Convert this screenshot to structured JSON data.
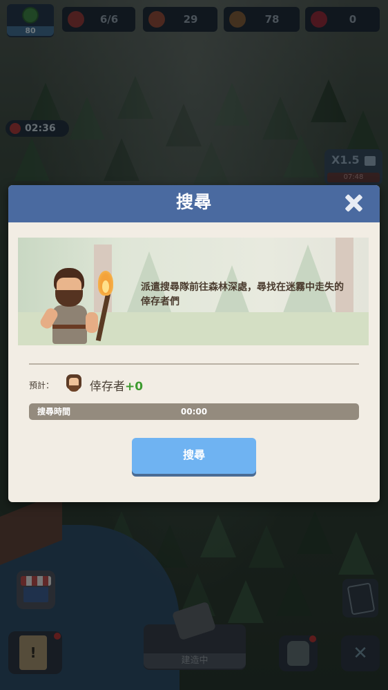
{
  "hud": {
    "level": "80",
    "resources": [
      {
        "icon": "survivor-capacity-icon",
        "value": "6/6"
      },
      {
        "icon": "meat-icon",
        "value": "29"
      },
      {
        "icon": "wood-icon",
        "value": "78"
      },
      {
        "icon": "gem-icon",
        "value": "0"
      }
    ],
    "event_timer": "02:36",
    "speed": {
      "multiplier": "X1.5",
      "remaining": "07:48"
    }
  },
  "modal": {
    "title": "搜尋",
    "banner_text": "派遣搜尋隊前往森林深處，尋找在迷霧中走失的倖存者們",
    "estimate_label": "預計：",
    "estimate_item": "倖存者",
    "estimate_bonus": "+0",
    "timebar_label": "搜尋時間",
    "timebar_value": "00:00",
    "timebar_progress": 0,
    "action_label": "搜尋"
  },
  "bottom": {
    "build_label": "建造中"
  },
  "colors": {
    "header": "#4a6aa0",
    "panel": "#f2ede4",
    "button": "#6fb3f2",
    "bonus": "#3c9a2e"
  }
}
